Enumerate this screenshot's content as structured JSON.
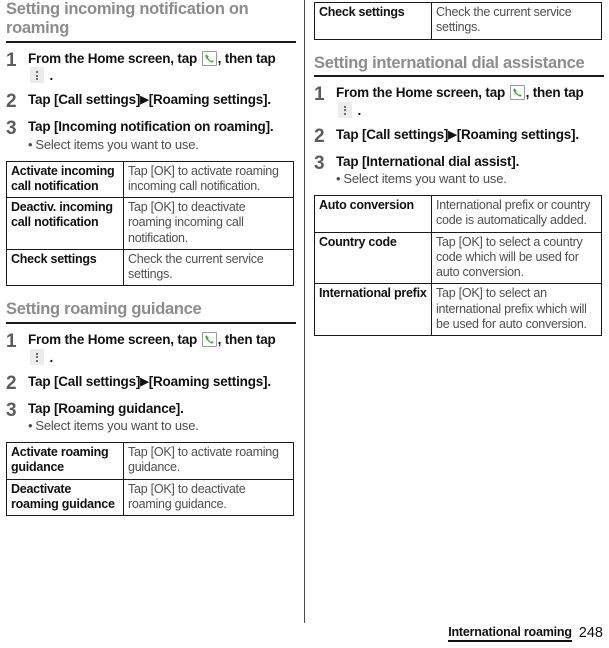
{
  "document": {
    "footer": {
      "chapter": "International roaming",
      "page_number": "248"
    }
  },
  "icons": {
    "phone": "phone-handset-icon",
    "menu": "overflow-menu-icon",
    "arrow": "▶",
    "bullet": "•"
  },
  "left_column": {
    "section1": {
      "heading": "Setting incoming notification on roaming",
      "steps": [
        {
          "number": "1",
          "text_before_phone": "From the Home screen, tap ",
          "text_between": ", then tap ",
          "text_after_menu": " ."
        },
        {
          "number": "2",
          "text_a": "Tap [Call settings]",
          "text_b": "[Roaming settings]."
        },
        {
          "number": "3",
          "text": "Tap [Incoming notification on roaming].",
          "substep": "Select items you want to use."
        }
      ],
      "table": {
        "rows": [
          {
            "term": "Activate incoming call notification",
            "desc": "Tap [OK] to activate roaming incoming call notification."
          },
          {
            "term": "Deactiv. incoming call notification",
            "desc": "Tap [OK] to deactivate roaming incoming call notification."
          },
          {
            "term": "Check settings",
            "desc": "Check the current service settings."
          }
        ]
      }
    },
    "section2": {
      "heading": "Setting roaming guidance",
      "steps": [
        {
          "number": "1",
          "text_before_phone": "From the Home screen, tap ",
          "text_between": ", then tap ",
          "text_after_menu": " ."
        },
        {
          "number": "2",
          "text_a": "Tap [Call settings]",
          "text_b": "[Roaming settings]."
        },
        {
          "number": "3",
          "text": "Tap [Roaming guidance].",
          "substep": "Select items you want to use."
        }
      ],
      "table": {
        "rows": [
          {
            "term": "Activate roaming guidance",
            "desc": "Tap [OK] to activate roaming guidance."
          },
          {
            "term": "Deactivate roaming guidance",
            "desc": "Tap [OK] to deactivate roaming guidance."
          }
        ]
      }
    }
  },
  "right_column": {
    "continued_table": {
      "rows": [
        {
          "term": "Check settings",
          "desc": "Check the current service settings."
        }
      ]
    },
    "section1": {
      "heading": "Setting international dial assistance",
      "steps": [
        {
          "number": "1",
          "text_before_phone": "From the Home screen, tap ",
          "text_between": ", then tap ",
          "text_after_menu": " ."
        },
        {
          "number": "2",
          "text_a": "Tap [Call settings]",
          "text_b": "[Roaming settings]."
        },
        {
          "number": "3",
          "text": "Tap [International dial assist].",
          "substep": "Select items you want to use."
        }
      ],
      "table": {
        "rows": [
          {
            "term": "Auto conversion",
            "desc": "International prefix or country code is automatically added."
          },
          {
            "term": "Country code",
            "desc": "Tap [OK] to select a country code which will be used for auto conversion."
          },
          {
            "term": "International prefix",
            "desc": "Tap [OK] to select an international prefix which will be used for auto conversion."
          }
        ]
      }
    }
  }
}
